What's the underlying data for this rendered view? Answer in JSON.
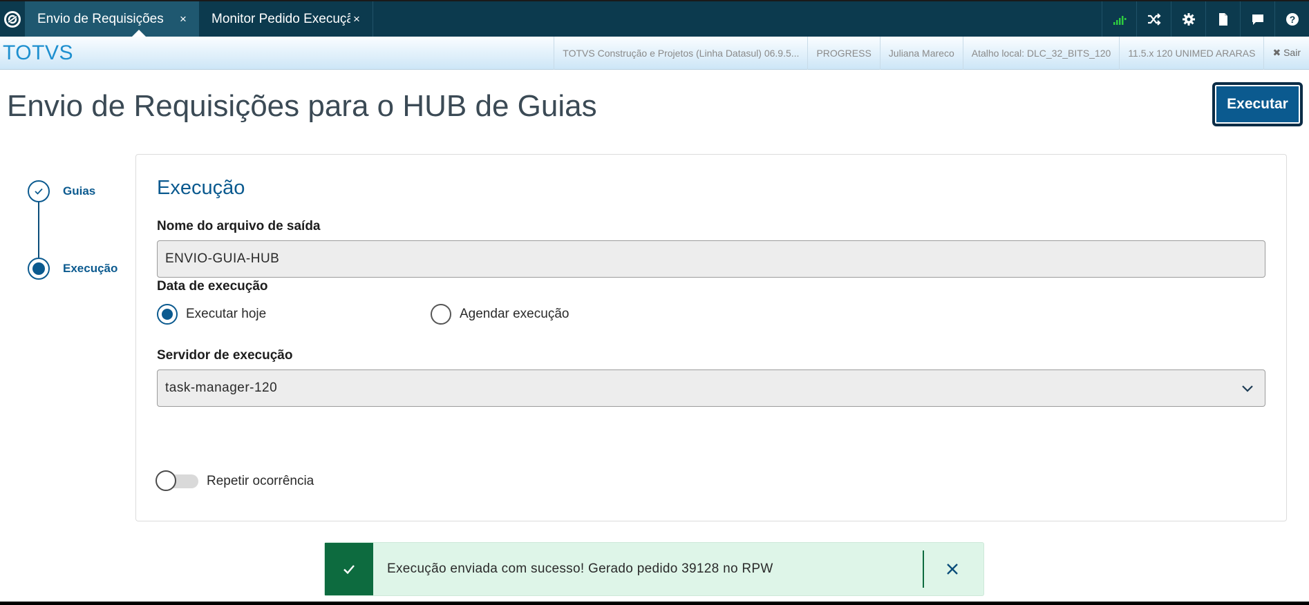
{
  "topbar": {
    "tabs": [
      {
        "label": "Envio de Requisições",
        "close": "×",
        "active": true
      },
      {
        "label": "Monitor Pedido Execução",
        "close": "×",
        "active": false
      }
    ],
    "actions": [
      {
        "icon": "signal-icon"
      },
      {
        "icon": "shuffle-icon"
      },
      {
        "icon": "gear-icon"
      },
      {
        "icon": "document-icon"
      },
      {
        "icon": "chat-icon"
      },
      {
        "icon": "help-icon"
      }
    ]
  },
  "subheader": {
    "brand": "TOTVS",
    "items": [
      "TOTVS Construção e Projetos (Linha Datasul) 06.9.5...",
      "PROGRESS",
      "Juliana Mareco",
      "Atalho local: DLC_32_BITS_120",
      "11.5.x 120 UNIMED ARARAS"
    ],
    "exit_label": "✖ Sair"
  },
  "page": {
    "title": "Envio de Requisições para o HUB de Guias",
    "run_button": "Executar"
  },
  "stepper": {
    "steps": [
      {
        "label": "Guias",
        "state": "done"
      },
      {
        "label": "Execução",
        "state": "current"
      }
    ]
  },
  "form": {
    "section_title": "Execução",
    "output_file": {
      "label": "Nome do arquivo de saída",
      "value": "ENVIO-GUIA-HUB"
    },
    "execution_date": {
      "label": "Data de execução",
      "options": [
        {
          "label": "Executar hoje",
          "checked": true
        },
        {
          "label": "Agendar execução",
          "checked": false
        }
      ]
    },
    "server": {
      "label": "Servidor de execução",
      "value": "task-manager-120"
    },
    "repeat": {
      "label": "Repetir ocorrência",
      "on": false
    }
  },
  "toast": {
    "message": "Execução enviada com sucesso! Gerado pedido 39128 no RPW",
    "colors": {
      "accent": "#0d6b3f",
      "background": "#def5e8"
    }
  },
  "colors": {
    "topbar": "#0c3a4e",
    "primary": "#0b5a8f",
    "brand": "#1d8fcf"
  }
}
